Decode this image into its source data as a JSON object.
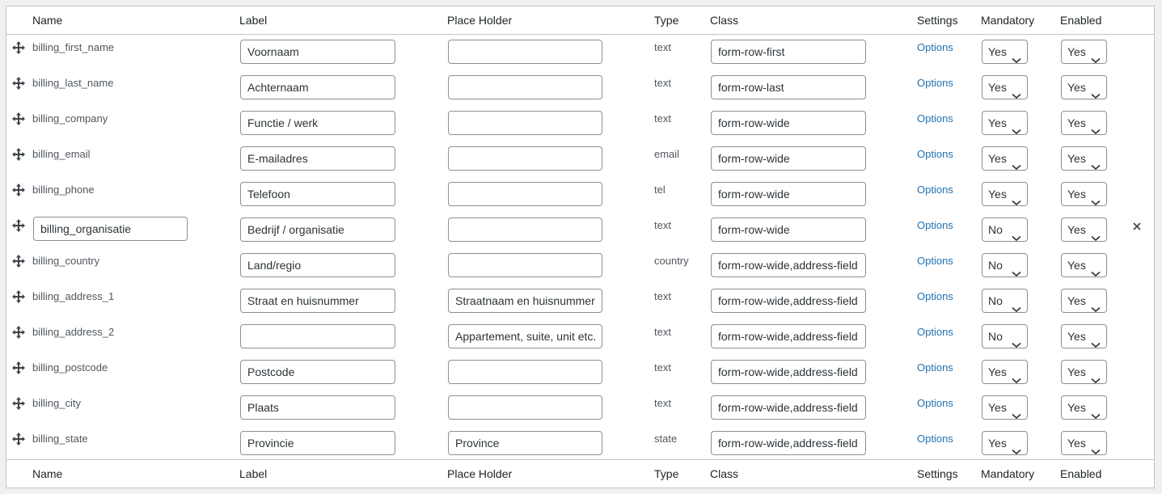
{
  "columns": {
    "name": "Name",
    "label": "Label",
    "placeholder": "Place Holder",
    "type": "Type",
    "class": "Class",
    "settings": "Settings",
    "mandatory": "Mandatory",
    "enabled": "Enabled"
  },
  "rows": [
    {
      "name": "billing_first_name",
      "label": "Voornaam",
      "placeholder": "",
      "type": "text",
      "class": "form-row-first",
      "settings": "Options",
      "mandatory": "Yes",
      "enabled": "Yes"
    },
    {
      "name": "billing_last_name",
      "label": "Achternaam",
      "placeholder": "",
      "type": "text",
      "class": "form-row-last",
      "settings": "Options",
      "mandatory": "Yes",
      "enabled": "Yes"
    },
    {
      "name": "billing_company",
      "label": "Functie / werk",
      "placeholder": "",
      "type": "text",
      "class": "form-row-wide",
      "settings": "Options",
      "mandatory": "Yes",
      "enabled": "Yes"
    },
    {
      "name": "billing_email",
      "label": "E-mailadres",
      "placeholder": "",
      "type": "email",
      "class": "form-row-wide",
      "settings": "Options",
      "mandatory": "Yes",
      "enabled": "Yes"
    },
    {
      "name": "billing_phone",
      "label": "Telefoon",
      "placeholder": "",
      "type": "tel",
      "class": "form-row-wide",
      "settings": "Options",
      "mandatory": "Yes",
      "enabled": "Yes"
    },
    {
      "name": "billing_organisatie",
      "label": "Bedrijf / organisatie",
      "placeholder": "",
      "type": "text",
      "class": "form-row-wide",
      "settings": "Options",
      "mandatory": "No",
      "enabled": "Yes",
      "editable_name": true,
      "removable": true
    },
    {
      "name": "billing_country",
      "label": "Land/regio",
      "placeholder": "",
      "type": "country",
      "class": "form-row-wide,address-field",
      "settings": "Options",
      "mandatory": "No",
      "enabled": "Yes"
    },
    {
      "name": "billing_address_1",
      "label": "Straat en huisnummer",
      "placeholder": "Straatnaam en huisnummer",
      "type": "text",
      "class": "form-row-wide,address-field",
      "settings": "Options",
      "mandatory": "No",
      "enabled": "Yes"
    },
    {
      "name": "billing_address_2",
      "label": "",
      "placeholder": "Appartement, suite, unit etc.",
      "type": "text",
      "class": "form-row-wide,address-field",
      "settings": "Options",
      "mandatory": "No",
      "enabled": "Yes"
    },
    {
      "name": "billing_postcode",
      "label": "Postcode",
      "placeholder": "",
      "type": "text",
      "class": "form-row-wide,address-field",
      "settings": "Options",
      "mandatory": "Yes",
      "enabled": "Yes"
    },
    {
      "name": "billing_city",
      "label": "Plaats",
      "placeholder": "",
      "type": "text",
      "class": "form-row-wide,address-field",
      "settings": "Options",
      "mandatory": "Yes",
      "enabled": "Yes"
    },
    {
      "name": "billing_state",
      "label": "Provincie",
      "placeholder": "Province",
      "type": "state",
      "class": "form-row-wide,address-field",
      "settings": "Options",
      "mandatory": "Yes",
      "enabled": "Yes"
    }
  ],
  "icons": {
    "drag": "move-icon",
    "select": "chevron-down-icon",
    "remove": "close-icon"
  },
  "colors": {
    "link": "#2271b1",
    "border": "#c3c4c7",
    "background": "#f0f0f1"
  }
}
